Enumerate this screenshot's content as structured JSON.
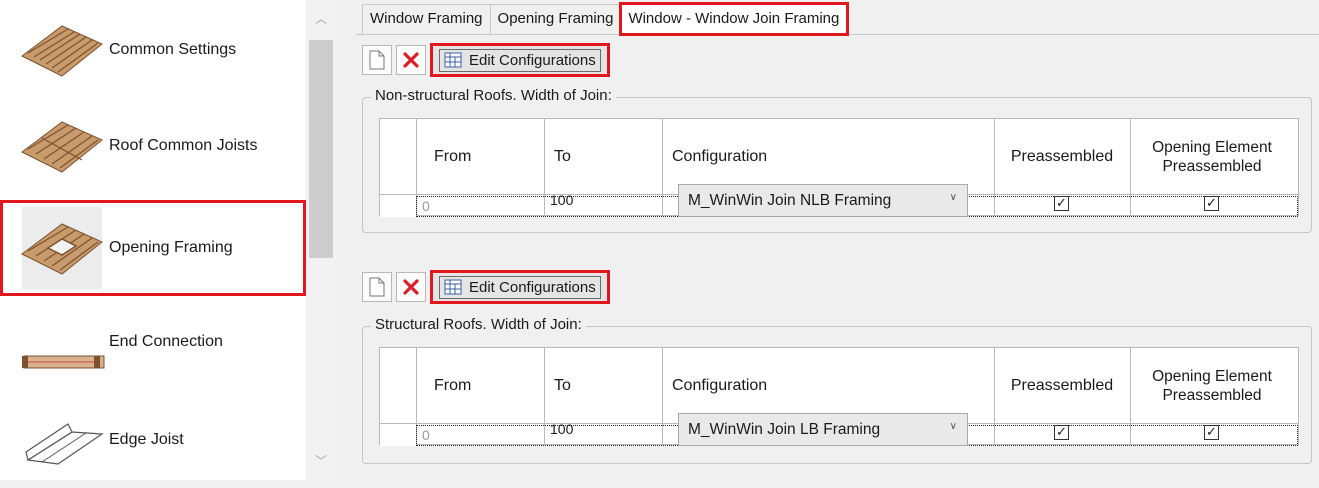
{
  "sidebar": {
    "items": [
      {
        "label": "Common Settings",
        "icon": "floor-joists-icon",
        "selected": false
      },
      {
        "label": "Roof Common Joists",
        "icon": "roof-joists-icon",
        "selected": false
      },
      {
        "label": "Opening Framing",
        "icon": "opening-framing-icon",
        "selected": true
      },
      {
        "label": "End Connection",
        "icon": "end-connection-icon",
        "selected": false
      },
      {
        "label": "Edge Joist",
        "icon": "edge-joist-icon",
        "selected": false
      }
    ]
  },
  "tabs": [
    {
      "label": "Window Framing",
      "active": false
    },
    {
      "label": "Opening Framing",
      "active": false
    },
    {
      "label": "Window - Window Join Framing",
      "active": true
    }
  ],
  "toolbar": {
    "new_icon": "new-document-icon",
    "delete_icon": "delete-x-icon",
    "edit_label": "Edit Configurations",
    "edit_icon": "table-grid-icon"
  },
  "groups": [
    {
      "title": "Non-structural Roofs. Width of Join:",
      "columns": [
        "From",
        "To",
        "Configuration",
        "Preassembled",
        "Opening Element Preassembled"
      ],
      "rows": [
        {
          "from": "0",
          "to": "100",
          "configuration": "M_WinWin Join NLB Framing",
          "preassembled": true,
          "opening_preassembled": true
        }
      ]
    },
    {
      "title": "Structural Roofs. Width of Join:",
      "columns": [
        "From",
        "To",
        "Configuration",
        "Preassembled",
        "Opening Element Preassembled"
      ],
      "rows": [
        {
          "from": "0",
          "to": "100",
          "configuration": "M_WinWin Join LB Framing",
          "preassembled": true,
          "opening_preassembled": true
        }
      ]
    }
  ],
  "colors": {
    "highlight": "#e0171f",
    "wood": "#b5835a"
  }
}
